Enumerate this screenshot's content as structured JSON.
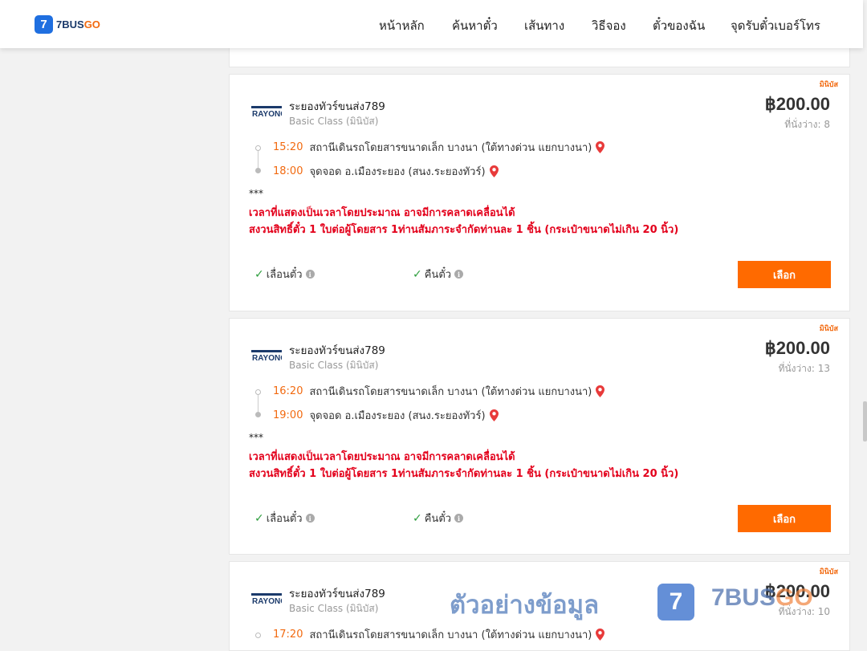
{
  "header": {
    "logo": {
      "mark": "7",
      "text_1": "7BUS",
      "text_2": "GO"
    },
    "nav": [
      "หน้าหลัก",
      "ค้นหาตั๋ว",
      "เส้นทาง",
      "วิธีจอง",
      "ตั๋วของฉัน",
      "จุดรับตั๋วเบอร์โทร"
    ]
  },
  "trips": [
    {
      "badge": "มินิบัส",
      "operator": "ระยองทัวร์ขนส่ง789",
      "class": "Basic Class (มินิบัส)",
      "price": "฿200.00",
      "seats": "ที่นั่งว่าง: 8",
      "depart": {
        "time": "15:20",
        "place": "สถานีเดินรถโดยสารขนาดเล็ก บางนา (ใต้ทางด่วน แยกบางนา)"
      },
      "arrive": {
        "time": "18:00",
        "place": "จุดจอด อ.เมืองระยอง (สนง.ระยองทัวร์)"
      },
      "note_stars": "***",
      "note_1": "เวลาที่แสดงเป็นเวลาโดยประมาณ อาจมีการคลาดเคลื่อนได้",
      "note_2": "สงวนสิทธิ์ตั๋ว 1 ใบต่อผู้โดยสาร 1ท่านสัมภาระจำกัดท่านละ 1 ชิ้น (กระเป๋าขนาดไม่เกิน 20 นิ้ว)",
      "feature_1": "เลื่อนตั๋ว",
      "feature_2": "คืนตั๋ว",
      "button": "เลือก"
    },
    {
      "badge": "มินิบัส",
      "operator": "ระยองทัวร์ขนส่ง789",
      "class": "Basic Class (มินิบัส)",
      "price": "฿200.00",
      "seats": "ที่นั่งว่าง: 13",
      "depart": {
        "time": "16:20",
        "place": "สถานีเดินรถโดยสารขนาดเล็ก บางนา (ใต้ทางด่วน แยกบางนา)"
      },
      "arrive": {
        "time": "19:00",
        "place": "จุดจอด อ.เมืองระยอง (สนง.ระยองทัวร์)"
      },
      "note_stars": "***",
      "note_1": "เวลาที่แสดงเป็นเวลาโดยประมาณ อาจมีการคลาดเคลื่อนได้",
      "note_2": "สงวนสิทธิ์ตั๋ว 1 ใบต่อผู้โดยสาร 1ท่านสัมภาระจำกัดท่านละ 1 ชิ้น (กระเป๋าขนาดไม่เกิน 20 นิ้ว)",
      "feature_1": "เลื่อนตั๋ว",
      "feature_2": "คืนตั๋ว",
      "button": "เลือก"
    },
    {
      "badge": "มินิบัส",
      "operator": "ระยองทัวร์ขนส่ง789",
      "class": "Basic Class (มินิบัส)",
      "price": "฿200.00",
      "seats": "ที่นั่งว่าง: 10",
      "depart": {
        "time": "17:20",
        "place": "สถานีเดินรถโดยสารขนาดเล็ก บางนา (ใต้ทางด่วน แยกบางนา)"
      }
    }
  ],
  "watermark": {
    "text": "ตัวอย่างข้อมูล",
    "mark": "7",
    "brand_1": "7BUS",
    "brand_2": "GO"
  },
  "colors": {
    "accent": "#ff6a00",
    "time": "#f26a10",
    "warning": "#e3001b",
    "check": "#2e9e3e",
    "logo_blue": "#1f6fe0"
  }
}
